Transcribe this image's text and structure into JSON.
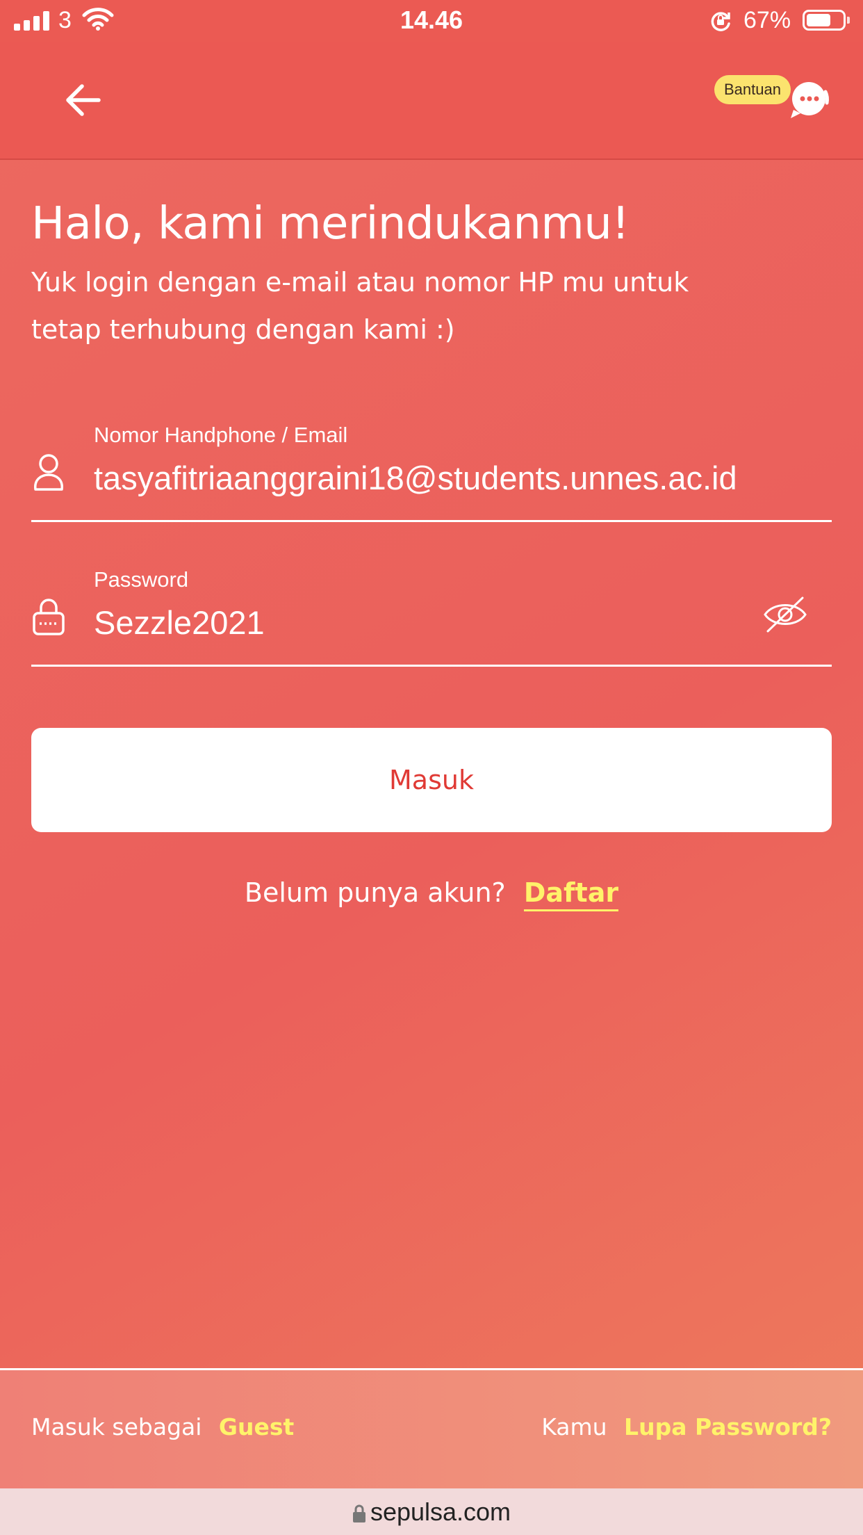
{
  "status_bar": {
    "carrier": "3",
    "time": "14.46",
    "battery_percent": "67%",
    "battery_level": 0.67
  },
  "header": {
    "back_icon": "arrow-left-icon",
    "help_label": "Bantuan",
    "help_icon": "chat-support-icon"
  },
  "intro": {
    "title": "Halo, kami merindukanmu!",
    "subtitle": "Yuk login dengan e-mail atau nomor HP mu untuk tetap terhubung dengan kami :)"
  },
  "form": {
    "email_label": "Nomor Handphone / Email",
    "email_value": "tasyafitriaanggraini18@students.unnes.ac.id",
    "email_icon": "user-icon",
    "password_label": "Password",
    "password_value": "Sezzle2021",
    "password_icon": "lock-icon",
    "visibility_icon": "eye-slash-icon",
    "submit_label": "Masuk"
  },
  "register": {
    "prompt": "Belum punya akun?",
    "link": "Daftar"
  },
  "footer": {
    "guest_prefix": "Masuk sebagai",
    "guest_link": "Guest",
    "forgot_prefix": "Kamu",
    "forgot_link": "Lupa Password?"
  },
  "browser": {
    "url": "sepulsa.com"
  },
  "colors": {
    "primary": "#eb5953",
    "accent_yellow": "#fff36a",
    "button_text": "#e03a35"
  }
}
